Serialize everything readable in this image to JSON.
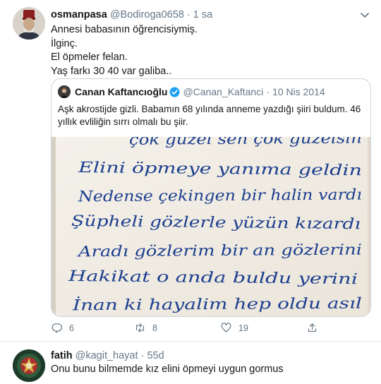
{
  "tweet": {
    "author_name": "osmanpasa",
    "author_handle": "@Bodiroga0658",
    "separator": "·",
    "time": "1 sa",
    "avatar_icon": "portrait-avatar",
    "menu_icon": "chevron-down-icon",
    "lines": [
      "Annesi babasının öğrencisiymiş.",
      "İlginç.",
      "El öpmeler felan.",
      "Yaş farkı 30 40 var galiba.."
    ],
    "quoted": {
      "author_name": "Canan Kaftancıoğlu",
      "verified": true,
      "author_handle": "@Canan_Kaftanci",
      "separator": "·",
      "time": "10 Nis 2014",
      "text": "Aşk akrostijde gizli. Babamın 68 yılında anneme yazdığı şiiri buldum. 46 yıllık evliliğin sırrı olmalı bu şiir.",
      "image": {
        "kind": "handwritten-poem-photo",
        "lines": [
          "çok güzel sen çok güzelsin",
          "Elini öpmeye yanıma geldin",
          "Nedense çekingen bir halin vardı",
          "Şüpheli gözlerle yüzün kızardı",
          "Aradı gözlerim bir an gözlerini",
          "Hakikat o anda buldu yerini",
          "İnan ki hayalim hep oldu asıl"
        ]
      }
    },
    "actions": {
      "reply_count": "6",
      "retweet_count": "8",
      "like_count": "19"
    }
  },
  "reply": {
    "author_name": "fatih",
    "author_handle": "@kagit_hayat",
    "separator": "·",
    "time": "55d",
    "avatar_icon": "emblem-avatar",
    "text": "Onu bunu bilmemde kız elini öpmeyi uygun gormus"
  },
  "colors": {
    "text_primary": "#14171a",
    "text_secondary": "#657786",
    "border": "#e6ecf0",
    "verified": "#1da1f2",
    "ink": "#1d3f8f"
  }
}
